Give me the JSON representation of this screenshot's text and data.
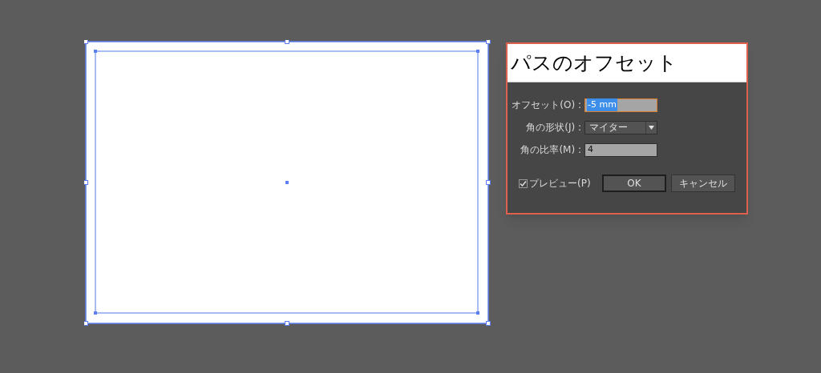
{
  "dialog": {
    "title": "パスのオフセット",
    "fields": [
      {
        "kind": "text",
        "label": "オフセット(O) :",
        "value": "-5 mm",
        "focused": true
      },
      {
        "kind": "dropdown",
        "label": "角の形状(J) :",
        "value": "マイター",
        "focused": false
      },
      {
        "kind": "text",
        "label": "角の比率(M) :",
        "value": "4",
        "focused": false
      }
    ],
    "preview": {
      "label": "プレビュー(P)",
      "checked": true
    },
    "buttons": [
      {
        "label": "OK",
        "default": true
      },
      {
        "label": "キャンセル",
        "default": false
      }
    ]
  }
}
